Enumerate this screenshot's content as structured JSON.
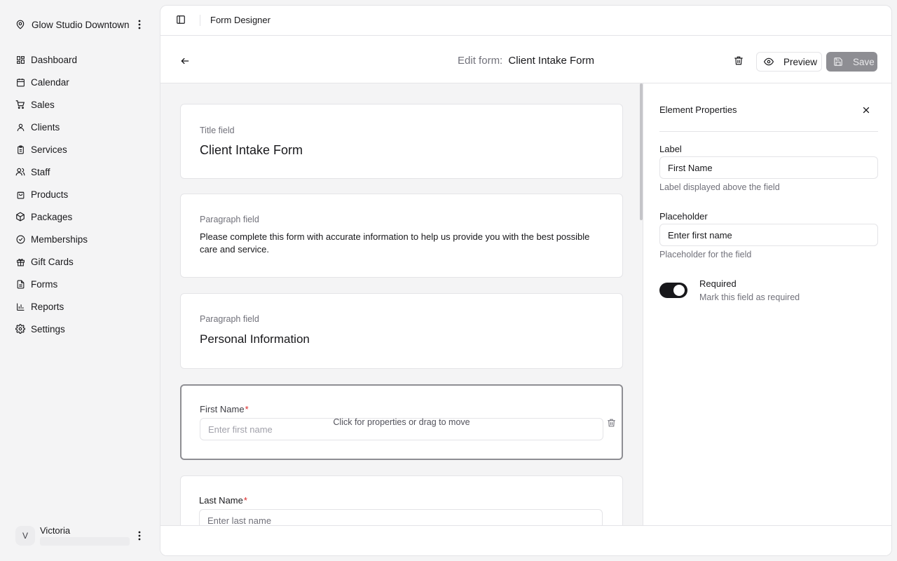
{
  "workspace": {
    "name": "Glow Studio Downtown"
  },
  "nav": {
    "items": [
      {
        "label": "Dashboard",
        "icon": "dashboard-icon"
      },
      {
        "label": "Calendar",
        "icon": "calendar-icon"
      },
      {
        "label": "Sales",
        "icon": "cart-icon"
      },
      {
        "label": "Clients",
        "icon": "user-icon"
      },
      {
        "label": "Services",
        "icon": "clipboard-icon"
      },
      {
        "label": "Staff",
        "icon": "users-icon"
      },
      {
        "label": "Products",
        "icon": "bag-icon"
      },
      {
        "label": "Packages",
        "icon": "package-icon"
      },
      {
        "label": "Memberships",
        "icon": "badge-check-icon"
      },
      {
        "label": "Gift Cards",
        "icon": "gift-icon"
      },
      {
        "label": "Forms",
        "icon": "file-icon"
      },
      {
        "label": "Reports",
        "icon": "bar-chart-icon"
      },
      {
        "label": "Settings",
        "icon": "gear-icon"
      }
    ]
  },
  "user": {
    "initial": "V",
    "name": "Victoria"
  },
  "topbar": {
    "title": "Form Designer"
  },
  "header": {
    "prefix": "Edit form:",
    "form_name": "Client Intake Form",
    "preview_label": "Preview",
    "save_label": "Save"
  },
  "canvas": {
    "title_card": {
      "type": "Title field",
      "text": "Client Intake Form"
    },
    "paragraph_card": {
      "type": "Paragraph field",
      "text": "Please complete this form with accurate information to help us provide you with the best possible care and service."
    },
    "section_card": {
      "type": "Paragraph field",
      "text": "Personal Information"
    },
    "first_name_card": {
      "label": "First Name",
      "required_mark": "*",
      "placeholder": "Enter first name",
      "hint": "Click for properties or drag to move"
    },
    "last_name_card": {
      "label": "Last Name",
      "required_mark": "*",
      "placeholder": "Enter last name"
    }
  },
  "properties": {
    "title": "Element Properties",
    "label_title": "Label",
    "label_value": "First Name",
    "label_help": "Label displayed above the field",
    "placeholder_title": "Placeholder",
    "placeholder_value": "Enter first name",
    "placeholder_help": "Placeholder for the field",
    "required_title": "Required",
    "required_desc": "Mark this field as required",
    "required_on": true
  },
  "colors": {
    "accent": "#18181b",
    "required": "#dc2626",
    "save_disabled": "#8e8e93"
  }
}
